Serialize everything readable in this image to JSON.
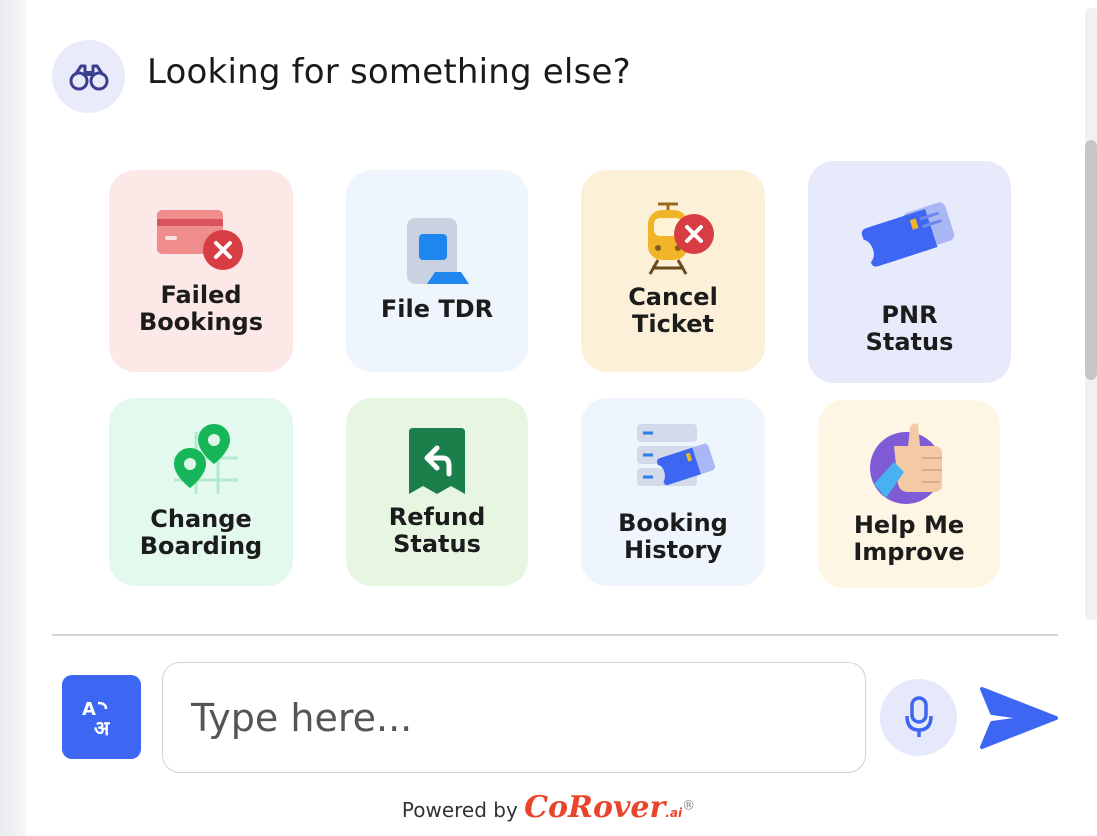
{
  "header": {
    "title": "Looking for something else?",
    "icon": "binoculars-icon"
  },
  "tiles": [
    {
      "label_line1": "Failed",
      "label_line2": "Bookings",
      "icon": "failed-card-icon",
      "bg": "#fde8e8"
    },
    {
      "label_line1": "File TDR",
      "label_line2": "",
      "icon": "document-icon",
      "bg": "#eef5fd"
    },
    {
      "label_line1": "Cancel",
      "label_line2": "Ticket",
      "icon": "train-cancel-icon",
      "bg": "#fcf1d8"
    },
    {
      "label_line1": "PNR",
      "label_line2": "Status",
      "icon": "ticket-icon",
      "bg": "#e7eafb"
    },
    {
      "label_line1": "Change",
      "label_line2": "Boarding",
      "icon": "location-pins-icon",
      "bg": "#e3f9ee"
    },
    {
      "label_line1": "Refund",
      "label_line2": "Status",
      "icon": "refund-icon",
      "bg": "#e6f6e1"
    },
    {
      "label_line1": "Booking",
      "label_line2": "History",
      "icon": "booking-history-icon",
      "bg": "#eef5fd"
    },
    {
      "label_line1": "Help Me",
      "label_line2": "Improve",
      "icon": "thumbs-up-icon",
      "bg": "#fdf6e4"
    }
  ],
  "input": {
    "placeholder": "Type here..."
  },
  "language_button": {
    "glyph": "A​अ"
  },
  "footer": {
    "powered_by": "Powered by",
    "brand": "CoRover",
    "brand_suffix": ".ai",
    "registered": "®"
  },
  "colors": {
    "accent": "#3d67f3",
    "brand": "#e8452a"
  }
}
